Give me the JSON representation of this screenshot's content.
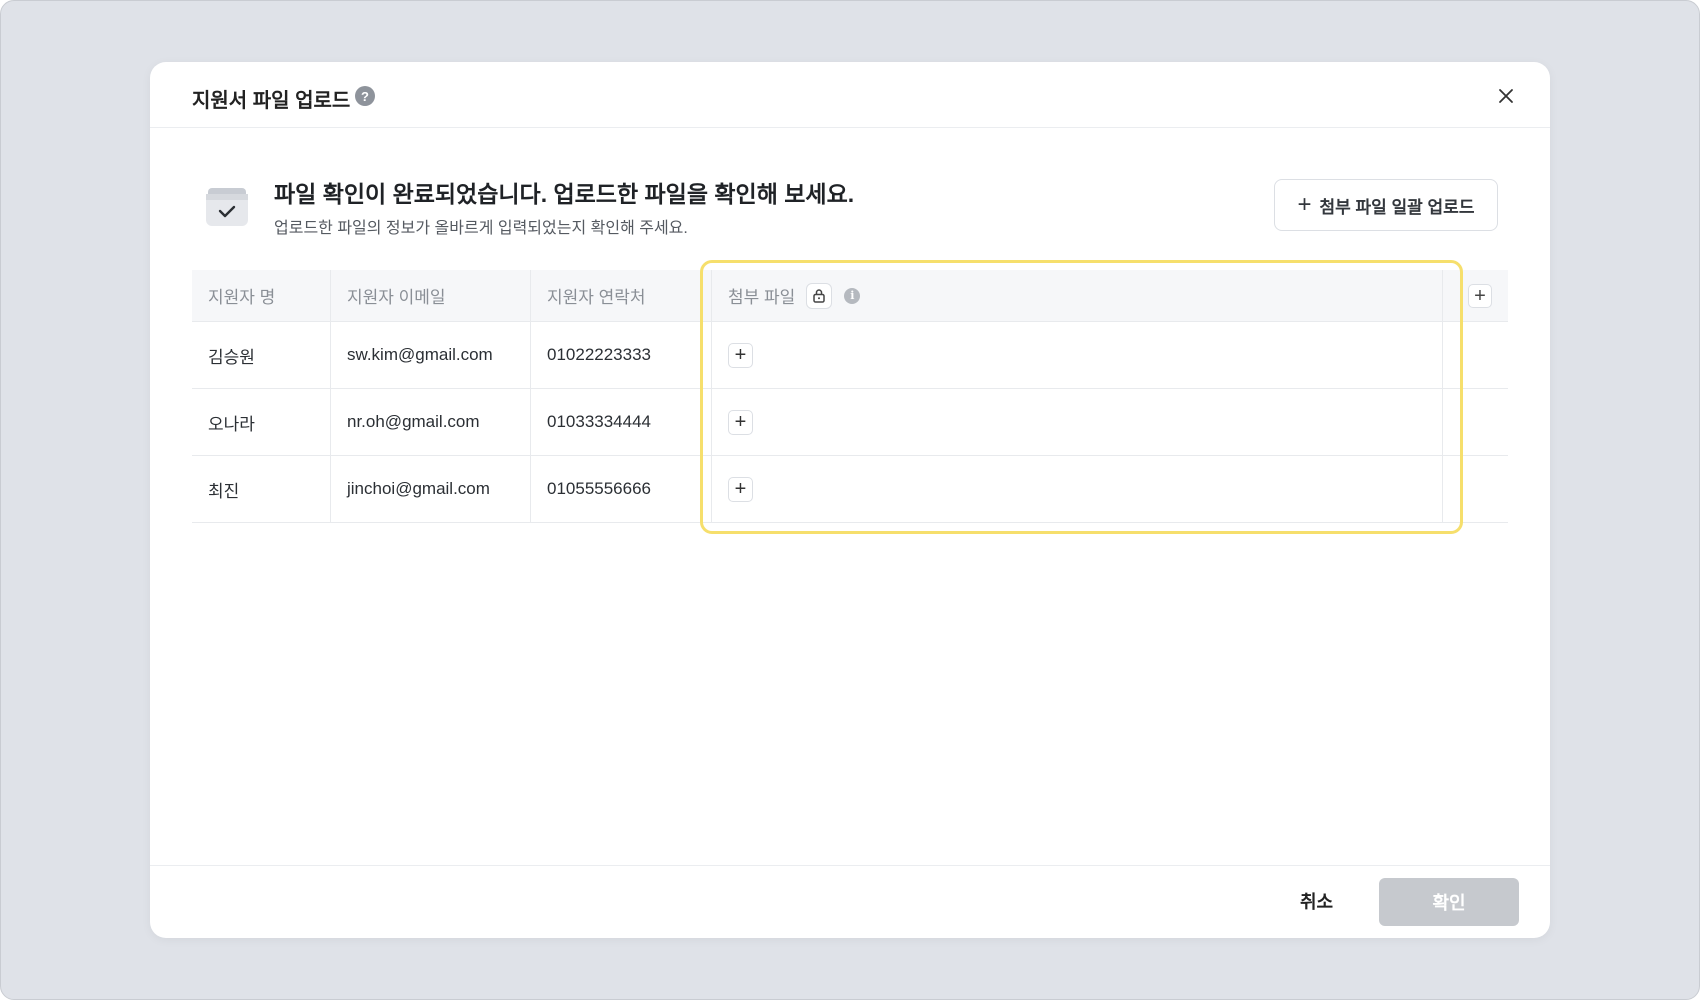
{
  "modal": {
    "title": "지원서 파일 업로드",
    "help_icon": "question-icon",
    "close_icon": "close-icon"
  },
  "notice": {
    "icon": "box-check-icon",
    "title": "파일 확인이 완료되었습니다. 업로드한 파일을 확인해 보세요.",
    "description": "업로드한 파일의 정보가 올바르게 입력되었는지 확인해 주세요.",
    "bulk_upload_label": "첨부 파일 일괄 업로드"
  },
  "table": {
    "headers": [
      "지원자 명",
      "지원자 이메일",
      "지원자 연락처",
      "첨부 파일"
    ],
    "rows": [
      {
        "name": "김승원",
        "email": "sw.kim@gmail.com",
        "phone": "01022223333"
      },
      {
        "name": "오나라",
        "email": "nr.oh@gmail.com",
        "phone": "01033334444"
      },
      {
        "name": "최진",
        "email": "jinchoi@gmail.com",
        "phone": "01055556666"
      }
    ]
  },
  "footer": {
    "cancel_label": "취소",
    "confirm_label": "확인"
  },
  "colors": {
    "highlight": "#f6df6c",
    "confirm_disabled": "#c6c9ce",
    "backdrop": "#dfe2e8"
  }
}
